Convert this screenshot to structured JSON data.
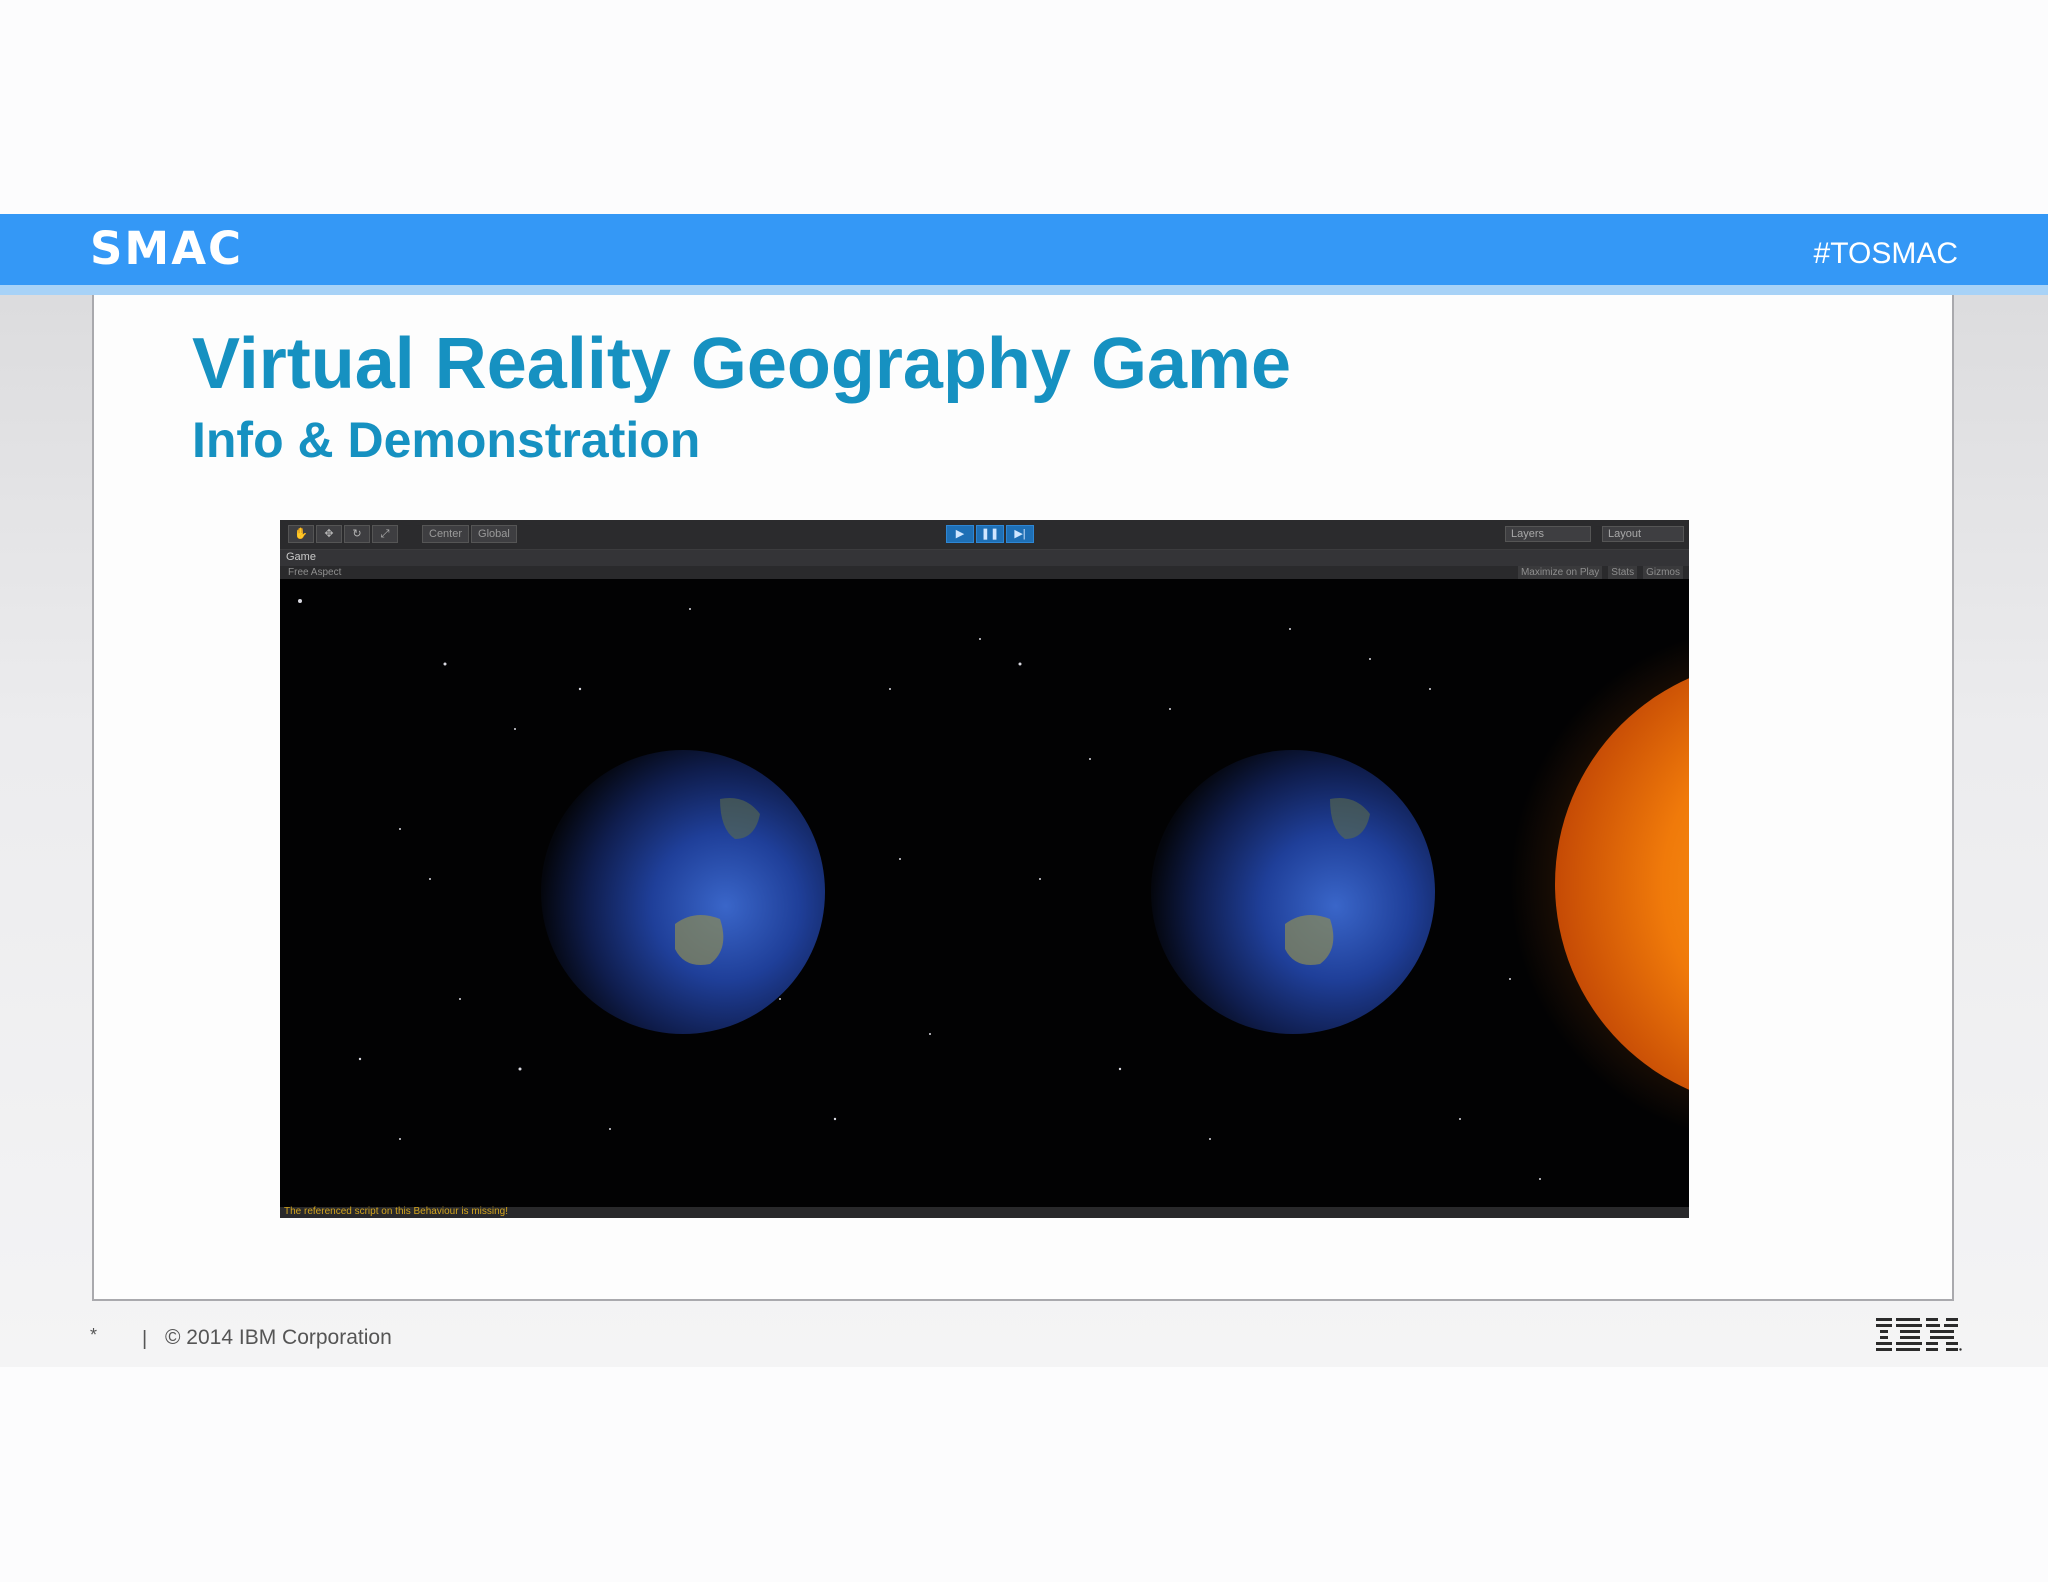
{
  "header": {
    "logo_text": "SMAC",
    "hashtag": "#TOSMAC",
    "bar_color": "#3498f6"
  },
  "slide": {
    "title": "Virtual Reality Geography Game",
    "subtitle": "Info & Demonstration",
    "title_color": "#1691c1"
  },
  "unity_editor": {
    "toolbar": {
      "tools": [
        "hand-icon",
        "move-icon",
        "rotate-icon",
        "scale-icon"
      ],
      "pivot_label": "Center",
      "space_label": "Global",
      "layers_label": "Layers",
      "layout_label": "Layout"
    },
    "game_tab_label": "Game",
    "aspect_label": "Free Aspect",
    "view_options": [
      "Maximize on Play",
      "Stats",
      "Gizmos"
    ],
    "status_message": "The referenced script on this Behaviour is missing!"
  },
  "footer": {
    "asterisk": "*",
    "separator": "|",
    "copyright": "© 2014 IBM Corporation",
    "brand": "IBM"
  }
}
